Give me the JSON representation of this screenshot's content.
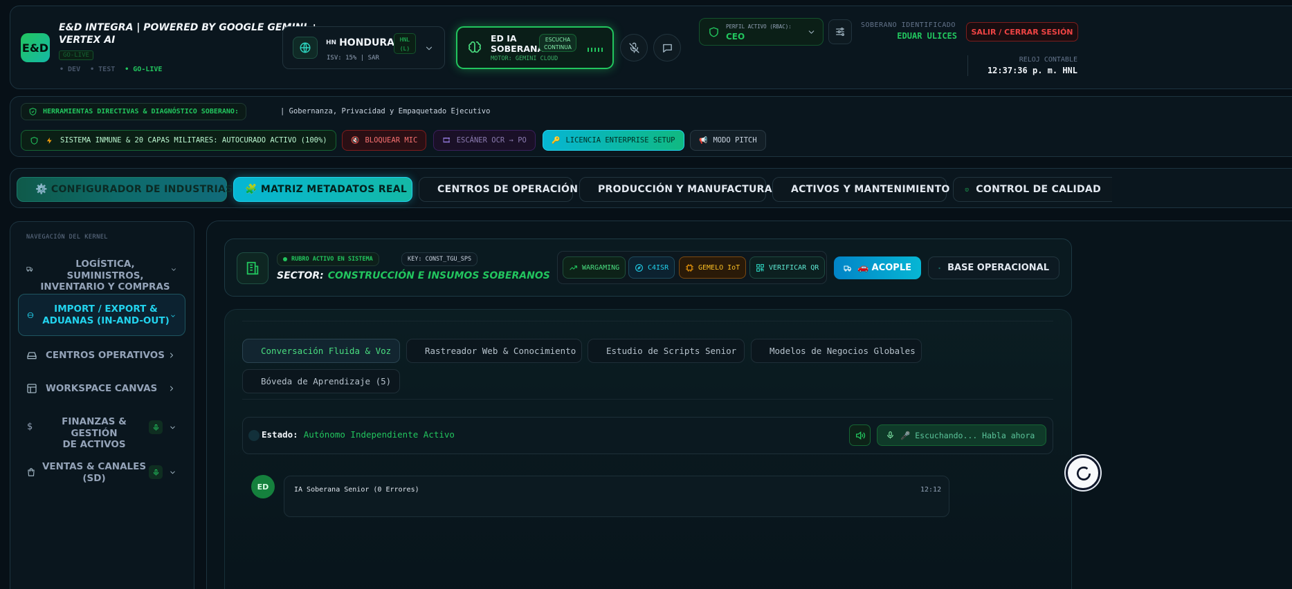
{
  "header": {
    "logo": "E&D",
    "title_line1": "E&D INTEGRA | POWERED BY GOOGLE GEMINI +",
    "title_line2": "VERTEX AI",
    "env_badge": "GO-LIVE",
    "envs": [
      "• DEV",
      "• TEST",
      "• GO-LIVE"
    ],
    "country_flag": "HN",
    "country": "HONDURAS",
    "currency_l1": "HNL",
    "currency_l2": "(L)",
    "tax": "ISV: 15% | SAR",
    "ai_title_l1": "ED IA",
    "ai_title_l2": "SOBERANA",
    "ai_badge_l1": "ESCUCHA",
    "ai_badge_l2": "CONTINUA",
    "ai_motor": "MOTOR: GEMINI CLOUD",
    "profile_label": "PERFIL ACTIVO (RBAC):",
    "profile_value": "CEO",
    "sovereign_label": "SOBERANO IDENTIFICADO",
    "sovereign_name": "EDUAR ULICES",
    "logout": "SALIR / CERRAR SESIÓN",
    "clock_label": "RELOJ CONTABLE",
    "clock_value": "12:37:36 p. m. HNL"
  },
  "tools": {
    "title": "HERRAMIENTAS DIRECTIVAS & DIAGNÓSTICO SOBERANO:",
    "subtitle": "| Gobernanza, Privacidad y Empaquetado Ejecutivo",
    "btn_immune": "SISTEMA INMUNE & 20 CAPAS MILITARES: AUTOCURADO ACTIVO (100%)",
    "btn_mic": "BLOQUEAR MIC",
    "btn_ocr": "ESCÁNER OCR → PO",
    "btn_license": "LICENCIA ENTERPRISE SETUP",
    "btn_pitch": "MODO PITCH"
  },
  "modules": [
    "⚙️ CONFIGURADOR DE INDUSTRIAS",
    "🧩 MATRIZ METADATOS REAL",
    "CENTROS DE OPERACIÓN",
    "PRODUCCIÓN Y MANUFACTURA",
    "ACTIVOS Y MANTENIMIENTO",
    "CONTROL DE CALIDAD"
  ],
  "sidebar": {
    "title": "NAVEGACIÓN DEL KERNEL",
    "items": [
      {
        "l1": "LOGÍSTICA, SUMINISTROS,",
        "l2": "INVENTARIO Y COMPRAS"
      },
      {
        "l1": "IMPORT / EXPORT &",
        "l2": "ADUANAS (IN-AND-OUT)"
      },
      {
        "l1": "CENTROS OPERATIVOS",
        "l2": ""
      },
      {
        "l1": "WORKSPACE CANVAS",
        "l2": ""
      },
      {
        "l1": "FINANZAS & GESTIÓN",
        "l2": "DE ACTIVOS"
      },
      {
        "l1": "VENTAS & CANALES",
        "l2": "(SD)"
      }
    ]
  },
  "sector": {
    "badge": "RUBRO ACTIVO EN SISTEMA",
    "key": "KEY: CONST_TGU_SPS",
    "label": "SECTOR:",
    "value": "CONSTRUCCIÓN E INSUMOS SOBERANOS",
    "btn_wargaming": "WARGAMING",
    "btn_c4isr": "C4ISR",
    "btn_gemelo": "GEMELO IoT",
    "btn_qr": "VERIFICAR QR",
    "btn_acople": "🚗 ACOPLE",
    "btn_base": "BASE OPERACIONAL"
  },
  "chat": {
    "tabs": [
      "Conversación Fluida & Voz",
      "Rastreador Web & Conocimiento",
      "Estudio de Scripts Senior",
      "Modelos de Negocios Globales",
      "Bóveda de Aprendizaje (5)"
    ],
    "status_label": "Estado:",
    "status_value": "Autónomo Independiente Activo",
    "listen_btn": "🎤 Escuchando... Habla ahora",
    "msg_avatar": "ED",
    "msg_author": "IA Soberana Senior (0 Errores)",
    "msg_time": "12:12"
  },
  "colors": {
    "accent_green": "#22c55e",
    "accent_teal": "#2dd4bf",
    "accent_cyan": "#06b6d4",
    "danger": "#ef4444",
    "bg": "#071017"
  }
}
